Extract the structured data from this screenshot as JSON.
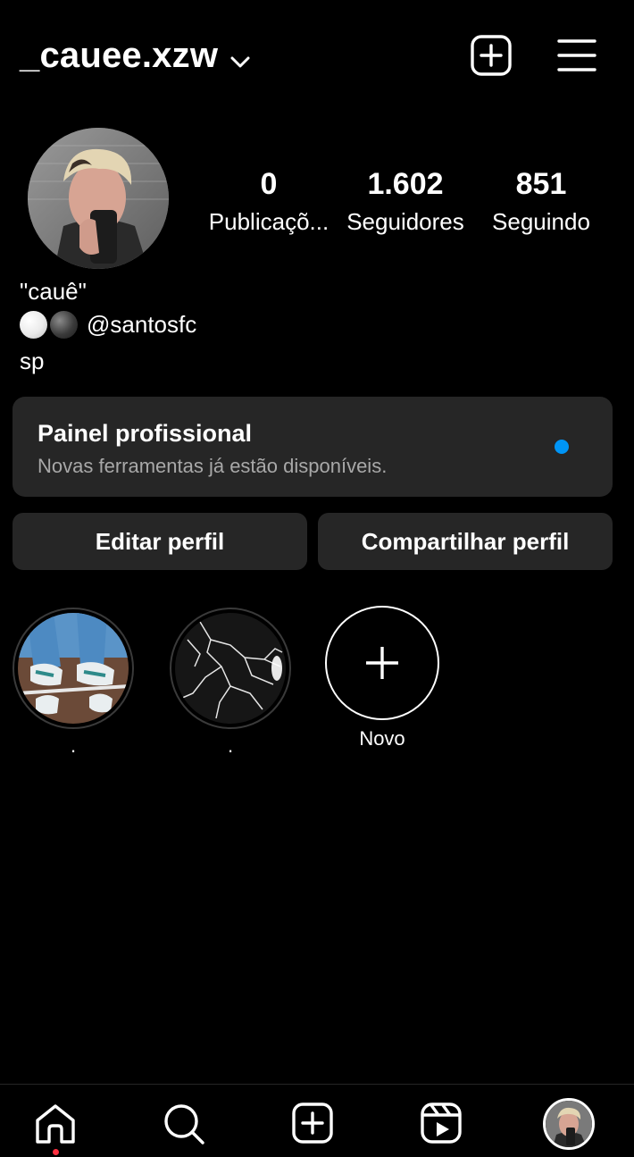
{
  "header": {
    "username": "_cauee.xzw",
    "username_icon": "chevron-down-icon",
    "create_icon": "plus-square-icon",
    "menu_icon": "hamburger-menu-icon"
  },
  "profile": {
    "avatar": "profile-photo"
  },
  "stats": [
    {
      "value": "0",
      "label": "Publicaçõ..."
    },
    {
      "value": "1.602",
      "label": "Seguidores"
    },
    {
      "value": "851",
      "label": "Seguindo"
    }
  ],
  "bio": {
    "name": "\"cauê\"",
    "line2_text": "@santosfc",
    "line3": "sp"
  },
  "pro_panel": {
    "title": "Painel profissional",
    "subtitle": "Novas ferramentas já estão disponíveis.",
    "dot_color": "#0095f6"
  },
  "buttons": {
    "edit": "Editar perfil",
    "share": "Compartilhar perfil"
  },
  "highlights": [
    {
      "label": "."
    },
    {
      "label": "."
    },
    {
      "label": "Novo"
    }
  ],
  "nav": {
    "items": [
      "home-icon",
      "search-icon",
      "create-icon",
      "reels-icon",
      "profile-avatar"
    ],
    "notification_color": "#ff3040"
  }
}
